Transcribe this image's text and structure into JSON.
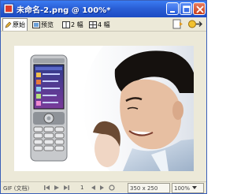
{
  "window": {
    "title": "未命名-2.png @ 100%*"
  },
  "toolbar": {
    "tabs": [
      {
        "label": "原始"
      },
      {
        "label": "预览"
      },
      {
        "label": "2 幅"
      },
      {
        "label": "4 幅"
      }
    ]
  },
  "statusbar": {
    "format": "GIF (文档)",
    "frame": "1",
    "dimensions": "350 x 250",
    "zoom": "100%"
  },
  "colors": {
    "titlebar": "#2a5fd6",
    "chrome": "#ece9d8"
  }
}
